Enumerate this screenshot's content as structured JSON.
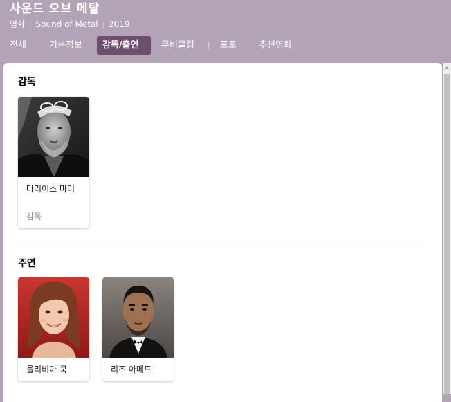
{
  "header": {
    "title": "사운드 오브 메탈",
    "category": "영화",
    "original_title": "Sound of Metal",
    "year": "2019"
  },
  "tabs": [
    {
      "label": "전체",
      "active": false
    },
    {
      "label": "기본정보",
      "active": false
    },
    {
      "label": "감독/출연",
      "active": true
    },
    {
      "label": "무비클립",
      "active": false
    },
    {
      "label": "포토",
      "active": false
    },
    {
      "label": "추천영화",
      "active": false
    }
  ],
  "sections": {
    "director": {
      "title": "감독",
      "people": [
        {
          "name": "다리어스 마더",
          "role": "감독",
          "photo_icon": "director-portrait-bw"
        }
      ]
    },
    "cast": {
      "title": "주연",
      "people": [
        {
          "name": "올리비아 쿡",
          "photo_icon": "actress-portrait"
        },
        {
          "name": "리즈 아메드",
          "photo_icon": "actor-portrait"
        }
      ]
    }
  },
  "colors": {
    "header_bg": "#b3a3b7",
    "active_tab_bg": "#6d4e6c",
    "panel_bg": "#ffffff"
  }
}
